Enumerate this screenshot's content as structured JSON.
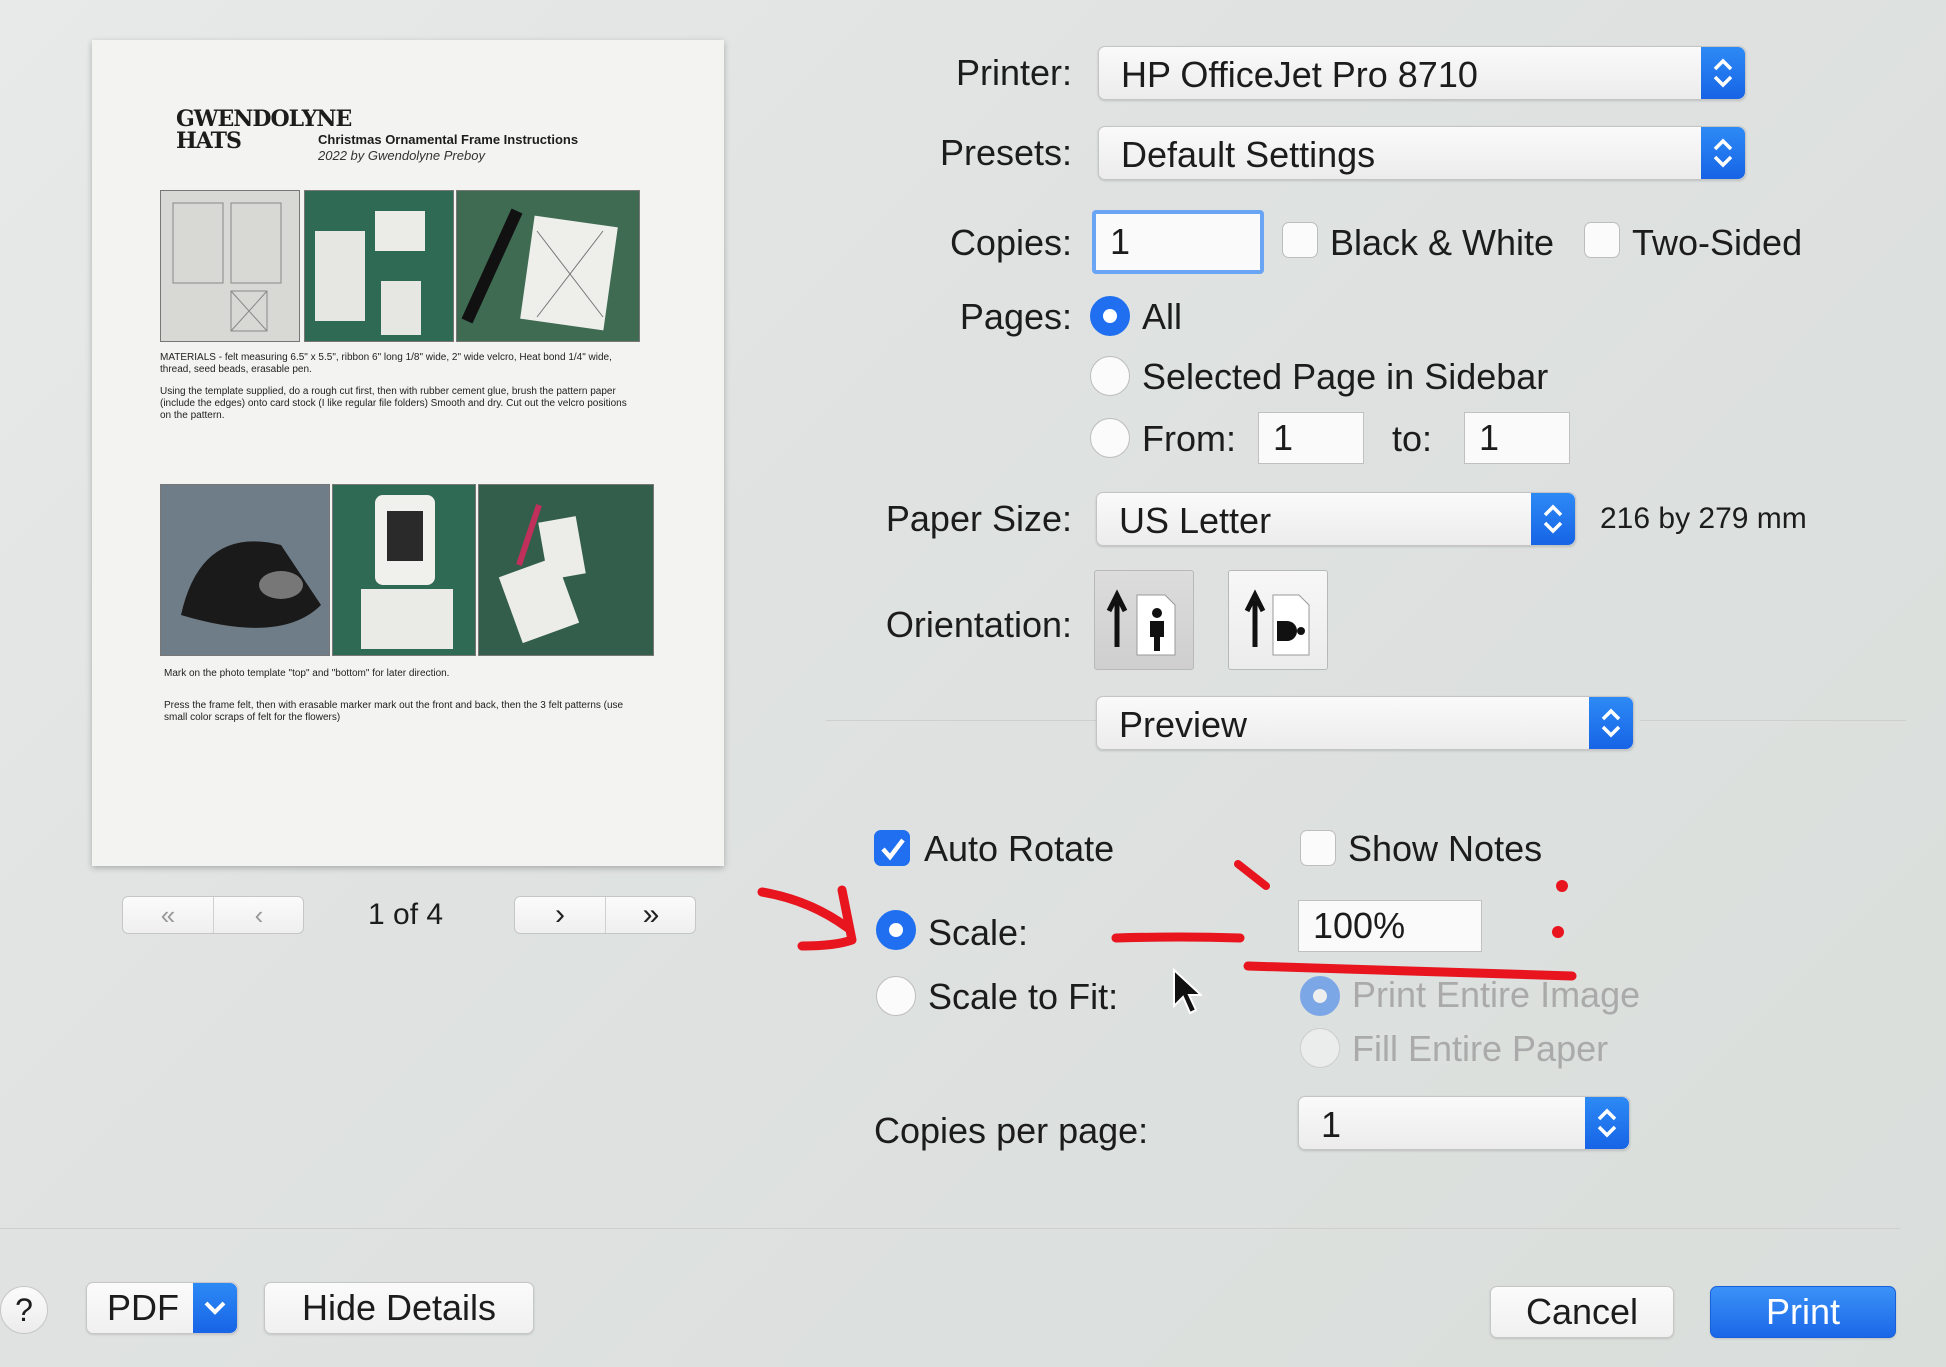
{
  "preview": {
    "doc_title": "Christmas Ornamental Frame Instructions",
    "doc_subtitle": "2022 by Gwendolyne Preboy",
    "logo_text": "GWENDOLYNE HATS",
    "materials_text": "MATERIALS - felt measuring 6.5\" x 5.5\", ribbon 6\" long 1/8\" wide, 2\" wide velcro, Heat bond 1/4\" wide, thread, seed beads, erasable pen.",
    "step1_text": "Using the template supplied, do a rough cut first, then with rubber cement glue, brush the pattern paper (include the edges) onto card stock (I like regular file folders) Smooth and dry. Cut out the velcro positions on the pattern.",
    "step2_text": "Mark on the photo template \"top\" and \"bottom\" for later direction.",
    "step3_text": "Press the frame felt, then with erasable marker mark out the front and back, then the 3 felt patterns (use small color scraps of felt for the flowers)",
    "page_indicator": "1 of 4"
  },
  "form": {
    "printer_label": "Printer:",
    "printer_value": "HP OfficeJet Pro 8710",
    "presets_label": "Presets:",
    "presets_value": "Default Settings",
    "copies_label": "Copies:",
    "copies_value": "1",
    "bw_label": "Black & White",
    "two_sided_label": "Two-Sided",
    "pages_label": "Pages:",
    "pages_all": "All",
    "pages_selected": "Selected Page in Sidebar",
    "pages_from": "From:",
    "from_value": "1",
    "pages_to": "to:",
    "to_value": "1",
    "paper_label": "Paper Size:",
    "paper_value": "US Letter",
    "paper_dims": "216 by 279 mm",
    "orientation_label": "Orientation:",
    "section_value": "Preview",
    "auto_rotate": "Auto Rotate",
    "show_notes": "Show Notes",
    "scale_label": "Scale:",
    "scale_value": "100%",
    "scale_fit_label": "Scale to Fit:",
    "print_entire": "Print Entire Image",
    "fill_entire": "Fill Entire Paper",
    "copies_per_page_label": "Copies per page:",
    "copies_per_page_value": "1"
  },
  "footer": {
    "help": "?",
    "pdf": "PDF",
    "hide_details": "Hide Details",
    "cancel": "Cancel",
    "print": "Print"
  },
  "colors": {
    "accent": "#1f6ff0",
    "annotation": "#e8141e"
  }
}
